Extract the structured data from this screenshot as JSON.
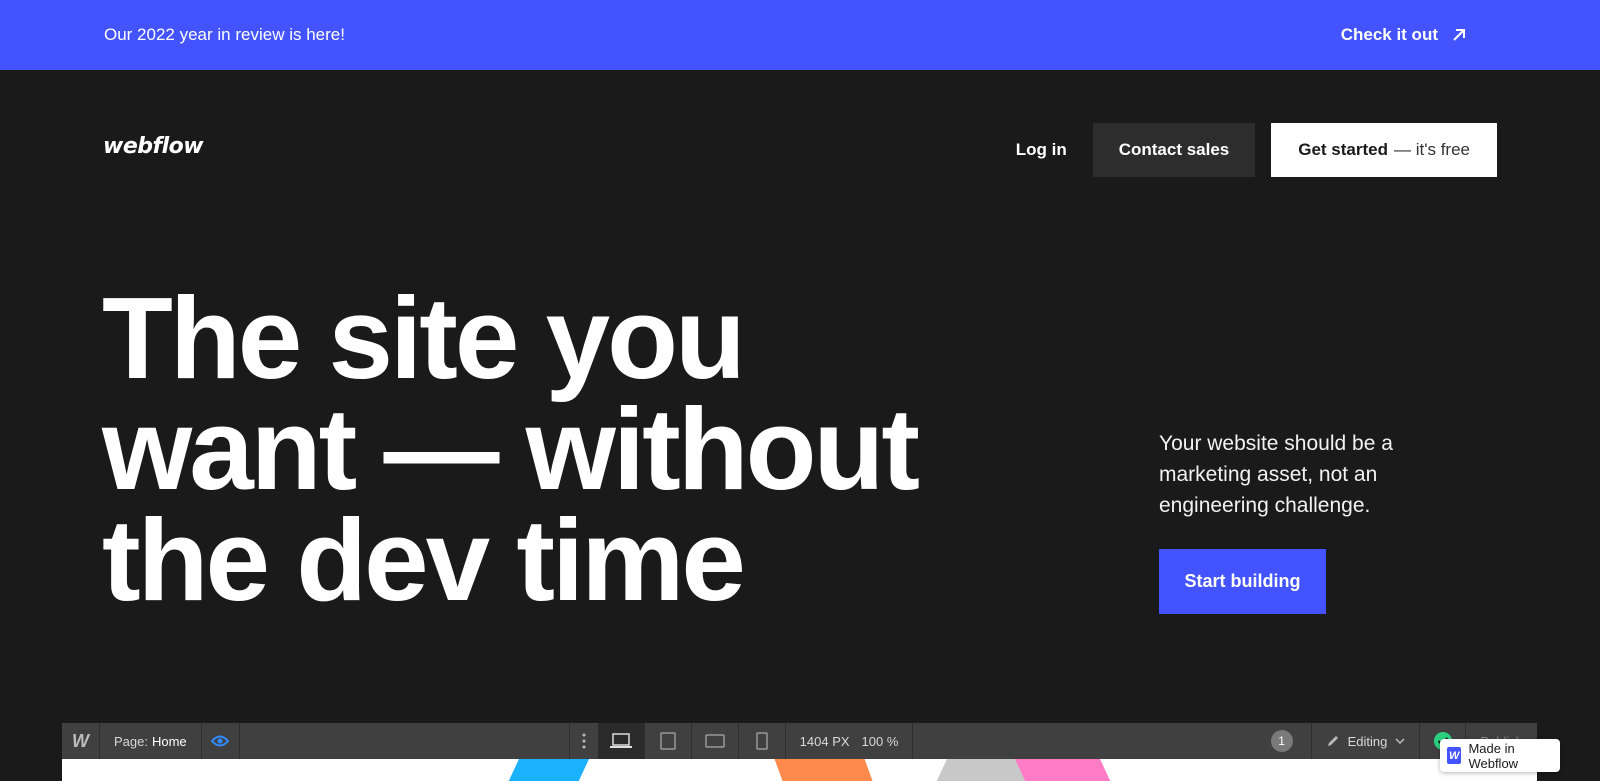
{
  "colors": {
    "accent": "#4353ff",
    "background": "#1a1a1a",
    "contact_button": "#2d2d2d"
  },
  "banner": {
    "text": "Our 2022 year in review is here!",
    "link_label": "Check it out",
    "link_icon": "arrow-up-right-icon"
  },
  "nav": {
    "logo": "webflow",
    "login_label": "Log in",
    "contact_label": "Contact sales",
    "get_started_label": "Get started",
    "get_started_suffix": "— it's free"
  },
  "hero": {
    "title_lines": [
      "The site you",
      "want — without",
      "the dev time"
    ],
    "subtitle": "Your website should be a marketing asset, not an engineering challenge.",
    "cta_label": "Start building"
  },
  "designer_toolbar": {
    "logo": "W",
    "page_label": "Page:",
    "page_value": "Home",
    "width_readout": "1404 PX",
    "zoom_readout": "100 %",
    "collaborator_count": "1",
    "mode_label": "Editing",
    "publish_label": "Publish",
    "devices": [
      "desktop-icon",
      "tablet-icon",
      "mobile-landscape-icon",
      "mobile-portrait-icon"
    ]
  },
  "made_in_badge": {
    "logo": "W",
    "label": "Made in Webflow"
  }
}
